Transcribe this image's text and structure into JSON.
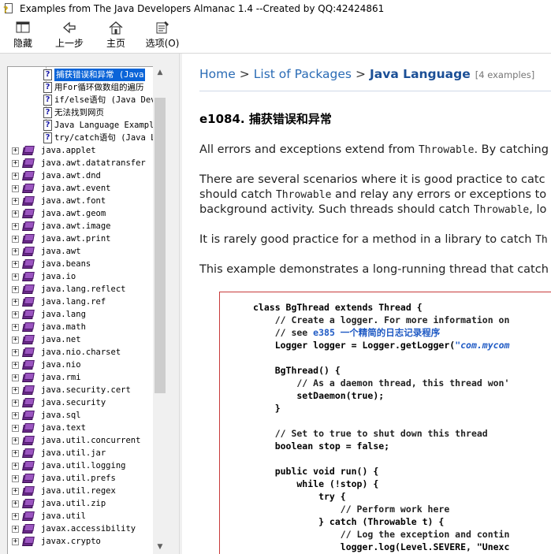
{
  "window": {
    "title": "Examples from The Java Developers Almanac 1.4 --Created by QQ:42424861"
  },
  "toolbar": {
    "hide": "隐藏",
    "back": "上一步",
    "home": "主页",
    "options": "选项(O)"
  },
  "tree": {
    "docs": [
      {
        "label": "捕获错误和异常 (Java",
        "selected": true
      },
      {
        "label": "用For循环做数组的遍历"
      },
      {
        "label": "if/else语句 (Java Dev"
      },
      {
        "label": "无法找到网页"
      },
      {
        "label": "Java Language Example"
      },
      {
        "label": "try/catch语句 (Java L"
      }
    ],
    "packages": [
      "java.applet",
      "java.awt.datatransfer",
      "java.awt.dnd",
      "java.awt.event",
      "java.awt.font",
      "java.awt.geom",
      "java.awt.image",
      "java.awt.print",
      "java.awt",
      "java.beans",
      "java.io",
      "java.lang.reflect",
      "java.lang.ref",
      "java.lang",
      "java.math",
      "java.net",
      "java.nio.charset",
      "java.nio",
      "java.rmi",
      "java.security.cert",
      "java.security",
      "java.sql",
      "java.text",
      "java.util.concurrent",
      "java.util.jar",
      "java.util.logging",
      "java.util.prefs",
      "java.util.regex",
      "java.util.zip",
      "java.util",
      "javax.accessibility",
      "javax.crypto"
    ]
  },
  "content": {
    "breadcrumb": {
      "home": "Home",
      "sep": ">",
      "list": "List of Packages",
      "current": "Java Language",
      "count": "[4 examples]"
    },
    "heading": "e1084. 捕获错误和异常",
    "p1": {
      "a": "All errors and exceptions extend from ",
      "b": "Throwable",
      "c": ". By catching"
    },
    "p2": {
      "l1": "There are several scenarios where it is good practice to catc",
      "l2a": "should catch ",
      "l2b": "Throwable",
      "l2c": " and relay any errors or exceptions to",
      "l3a": "background activity. Such threads should catch ",
      "l3b": "Throwable",
      "l3c": ", lo"
    },
    "p3": {
      "a": "It is rarely good practice for a method in a library to catch ",
      "b": "Th"
    },
    "p4": "This example demonstrates a long-running thread that catch",
    "code": {
      "l1": "class BgThread extends Thread {",
      "l2": "    // Create a logger. For more information on",
      "l3a": "    // see ",
      "l3b": "e385 一个精简的日志记录程序",
      "l4a": "    Logger logger = Logger.getLogger(",
      "l4b": "\"com.mycom",
      "l5": "    BgThread() {",
      "l6": "        // As a daemon thread, this thread won'",
      "l7": "        setDaemon(true);",
      "l8": "    }",
      "l9": "    // Set to true to shut down this thread",
      "l10": "    boolean stop = false;",
      "l11": "    public void run() {",
      "l12": "        while (!stop) {",
      "l13": "            try {",
      "l14": "                // Perform work here",
      "l15": "            } catch (Throwable t) {",
      "l16": "                // Log the exception and contin",
      "l17": "                logger.log(Level.SEVERE, \"Unexc"
    }
  },
  "colors": {
    "link": "#2a6bb5",
    "selection": "#0a64d8",
    "code_border": "#c83a3a"
  }
}
